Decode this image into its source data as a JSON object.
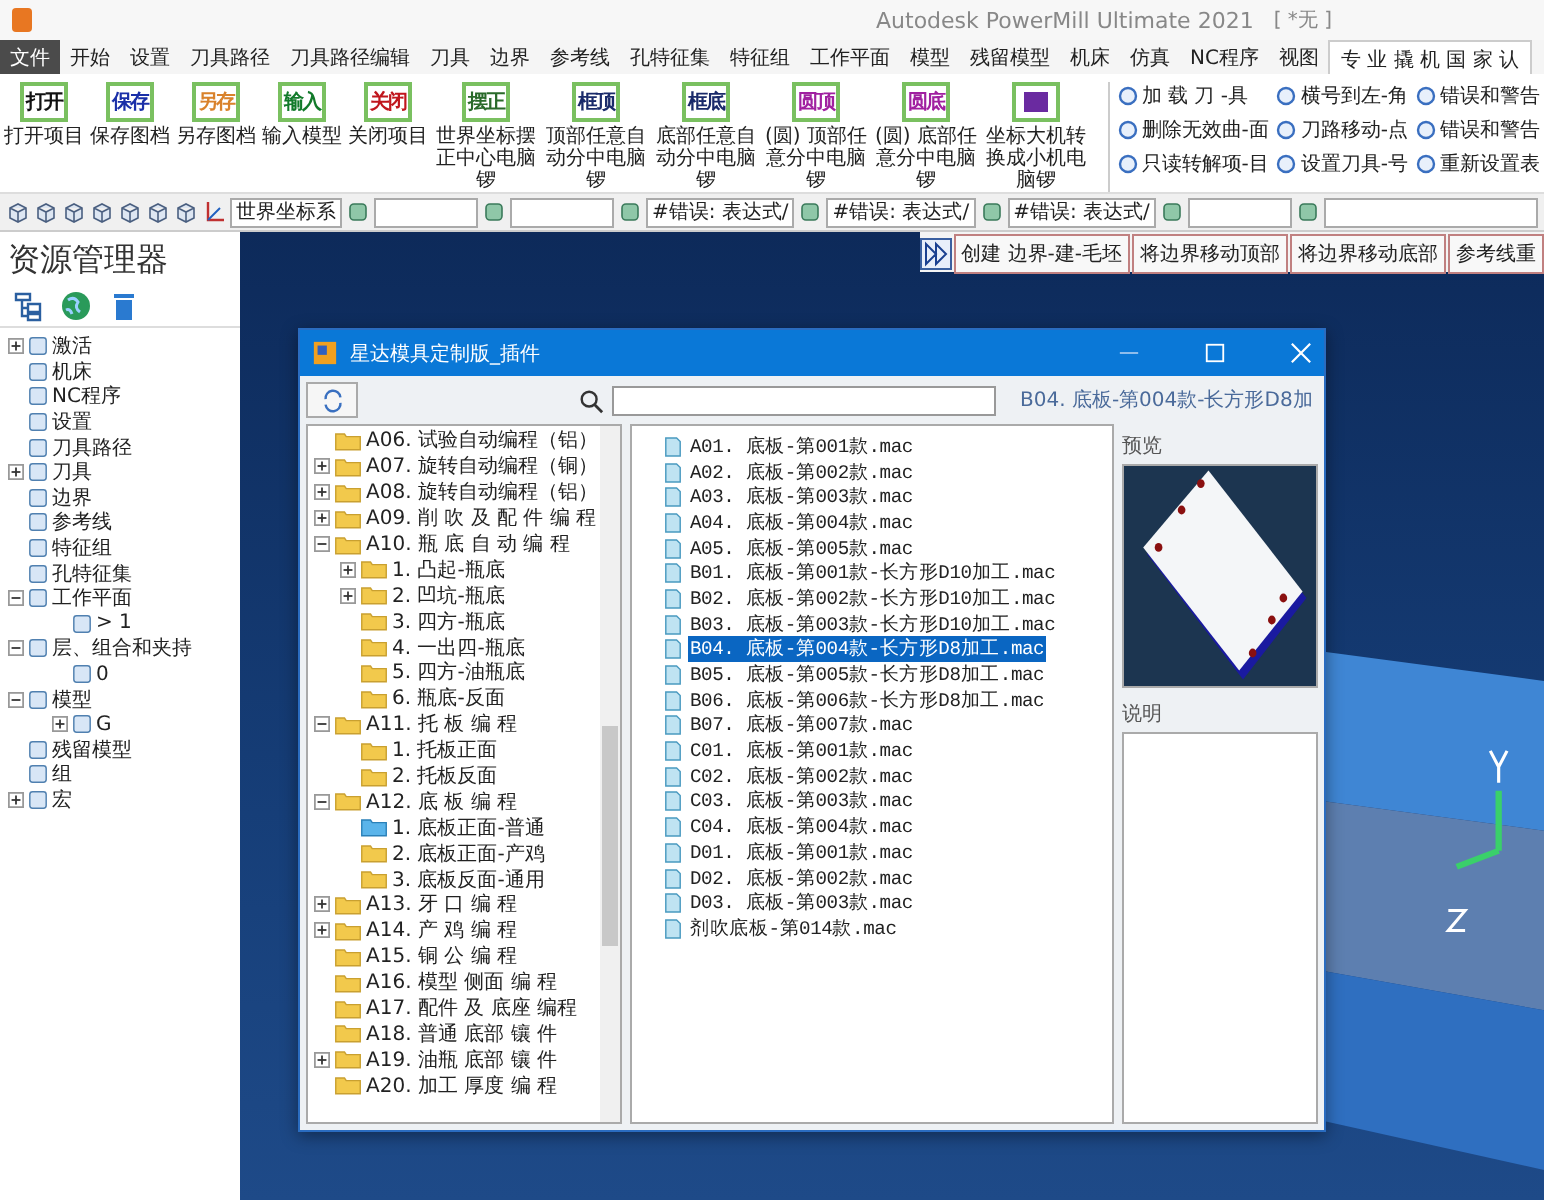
{
  "app": {
    "title": "Autodesk PowerMill Ultimate 2021",
    "document": "[ *无 ]"
  },
  "tabs": [
    {
      "label": "文件",
      "kind": "file",
      "selected": false
    },
    {
      "label": "开始",
      "kind": "tab",
      "selected": false
    },
    {
      "label": "设置",
      "kind": "tab",
      "selected": false
    },
    {
      "label": "刀具路径",
      "kind": "tab",
      "selected": false
    },
    {
      "label": "刀具路径编辑",
      "kind": "tab",
      "selected": false
    },
    {
      "label": "刀具",
      "kind": "tab",
      "selected": false
    },
    {
      "label": "边界",
      "kind": "tab",
      "selected": false
    },
    {
      "label": "参考线",
      "kind": "tab",
      "selected": false
    },
    {
      "label": "孔特征集",
      "kind": "tab",
      "selected": false
    },
    {
      "label": "特征组",
      "kind": "tab",
      "selected": false
    },
    {
      "label": "工作平面",
      "kind": "tab",
      "selected": false
    },
    {
      "label": "模型",
      "kind": "tab",
      "selected": false
    },
    {
      "label": "残留模型",
      "kind": "tab",
      "selected": false
    },
    {
      "label": "机床",
      "kind": "tab",
      "selected": false
    },
    {
      "label": "仿真",
      "kind": "tab",
      "selected": false
    },
    {
      "label": "NC程序",
      "kind": "tab",
      "selected": false
    },
    {
      "label": "视图",
      "kind": "tab",
      "selected": false
    },
    {
      "label": "专 业 撬 机 国 家 认",
      "kind": "tab",
      "selected": true
    }
  ],
  "ribbon": {
    "buttons": [
      {
        "label": "打开项目",
        "icon_text": "打开",
        "color": "#111111"
      },
      {
        "label": "保存图档",
        "icon_text": "保存",
        "color": "#1a2fa8"
      },
      {
        "label": "另存图档",
        "icon_text": "另存",
        "color": "#d9822b"
      },
      {
        "label": "输入模型",
        "icon_text": "输入",
        "color": "#127a2a"
      },
      {
        "label": "关闭项目",
        "icon_text": "关闭",
        "color": "#c0161d"
      },
      {
        "label": "世界坐标摆正中心电脑锣",
        "icon_text": "摆正",
        "color": "#2a6a2a"
      },
      {
        "label": "顶部任意自动分中电脑锣",
        "icon_text": "框顶",
        "color": "#1a2a6a"
      },
      {
        "label": "底部任意自动分中电脑锣",
        "icon_text": "框底",
        "color": "#1a2a6a"
      },
      {
        "label": "(圆) 顶部任意分中电脑锣",
        "icon_text": "圆顶",
        "color": "#a020a0"
      },
      {
        "label": "(圆) 底部任意分中电脑锣",
        "icon_text": "圆底",
        "color": "#a020a0"
      },
      {
        "label": "坐标大机转换成小机电脑锣",
        "color": "#6a2aa0"
      }
    ],
    "quick_buttons": [
      "加 载 刀 -具",
      "横号到左-角",
      "错误和警告",
      "删除无效曲-面",
      "刀路移动-点",
      "错误和警告",
      "只读转解项-目",
      "设置刀具-号",
      "重新设置表"
    ]
  },
  "toolbar": {
    "fields": [
      "世界坐标系",
      "#错误: 表达式/",
      "#错误: 表达式/",
      "#错误: 表达式/"
    ]
  },
  "explorer": {
    "title": "资源管理器",
    "tree": [
      {
        "label": "激活",
        "expanded": false
      },
      {
        "label": "机床"
      },
      {
        "label": "NC程序"
      },
      {
        "label": "设置"
      },
      {
        "label": "刀具路径"
      },
      {
        "label": "刀具",
        "expanded": false
      },
      {
        "label": "边界"
      },
      {
        "label": "参考线"
      },
      {
        "label": "特征组"
      },
      {
        "label": "孔特征集"
      },
      {
        "label": "工作平面",
        "expanded": true,
        "children": [
          {
            "label": "> 1"
          }
        ]
      },
      {
        "label": "层、组合和夹持",
        "expanded": true,
        "children": [
          {
            "label": "0"
          }
        ]
      },
      {
        "label": "模型",
        "expanded": true,
        "children": [
          {
            "label": "G",
            "expanded": false
          }
        ]
      },
      {
        "label": "残留模型"
      },
      {
        "label": "组"
      },
      {
        "label": "宏",
        "expanded": false
      }
    ]
  },
  "viewport": {
    "buttons": [
      "创建 边界-建-毛坯",
      "将边界移动顶部",
      "将边界移动底部",
      "参考线重"
    ]
  },
  "dialog": {
    "title": "星达模具定制版_插件",
    "tree": [
      {
        "label": "A06. 试验自动编程（铝）",
        "selected": false
      },
      {
        "label": "A07. 旋转自动编程（铜）",
        "expanded": false,
        "selected": false
      },
      {
        "label": "A08. 旋转自动编程（铝）",
        "expanded": false,
        "selected": false
      },
      {
        "label": "A09. 削 吹 及 配 件 编 程",
        "expanded": false,
        "selected": false
      },
      {
        "label": "A10. 瓶 底 自 动 编 程",
        "expanded": true,
        "selected": false,
        "children": [
          {
            "label": "1. 凸起-瓶底",
            "expanded": false,
            "selected": false
          },
          {
            "label": "2. 凹坑-瓶底",
            "expanded": false,
            "selected": false
          },
          {
            "label": "3. 四方-瓶底",
            "selected": false
          },
          {
            "label": "4. 一出四-瓶底",
            "selected": false
          },
          {
            "label": "5. 四方-油瓶底",
            "selected": false
          },
          {
            "label": "6. 瓶底-反面",
            "selected": false
          }
        ]
      },
      {
        "label": "A11. 托 板 编 程",
        "expanded": true,
        "selected": false,
        "children": [
          {
            "label": "1. 托板正面",
            "selected": false
          },
          {
            "label": "2. 托板反面",
            "selected": false
          }
        ]
      },
      {
        "label": "A12. 底 板 编 程",
        "expanded": true,
        "selected": false,
        "children": [
          {
            "label": "1. 底板正面-普通",
            "selected": true
          },
          {
            "label": "2. 底板正面-产鸡",
            "selected": false
          },
          {
            "label": "3. 底板反面-通用",
            "selected": false
          }
        ]
      },
      {
        "label": "A13. 牙 口 编 程",
        "expanded": false,
        "selected": false
      },
      {
        "label": "A14. 产 鸡 编 程",
        "expanded": false,
        "selected": false
      },
      {
        "label": "A15. 铜 公 编 程",
        "selected": false
      },
      {
        "label": "A16. 模型 侧面 编 程",
        "selected": false
      },
      {
        "label": "A17. 配件 及 底座 编程",
        "selected": false
      },
      {
        "label": "A18. 普通 底部 镶 件",
        "selected": false
      },
      {
        "label": "A19. 油瓶 底部 镶 件",
        "expanded": false,
        "selected": false
      },
      {
        "label": "A20. 加工 厚度 编 程",
        "selected": false
      }
    ],
    "files": [
      {
        "label": "A01. 底板-第001款.mac",
        "selected": false
      },
      {
        "label": "A02. 底板-第002款.mac",
        "selected": false
      },
      {
        "label": "A03. 底板-第003款.mac",
        "selected": false
      },
      {
        "label": "A04. 底板-第004款.mac",
        "selected": false
      },
      {
        "label": "A05. 底板-第005款.mac",
        "selected": false
      },
      {
        "label": "B01. 底板-第001款-长方形D10加工.mac",
        "selected": false
      },
      {
        "label": "B02. 底板-第002款-长方形D10加工.mac",
        "selected": false
      },
      {
        "label": "B03. 底板-第003款-长方形D10加工.mac",
        "selected": false
      },
      {
        "label": "B04. 底板-第004款-长方形D8加工.mac",
        "selected": true
      },
      {
        "label": "B05. 底板-第005款-长方形D8加工.mac",
        "selected": false
      },
      {
        "label": "B06. 底板-第006款-长方形D8加工.mac",
        "selected": false
      },
      {
        "label": "B07. 底板-第007款.mac",
        "selected": false
      },
      {
        "label": "C01. 底板-第001款.mac",
        "selected": false
      },
      {
        "label": "C02. 底板-第002款.mac",
        "selected": false
      },
      {
        "label": "C03. 底板-第003款.mac",
        "selected": false
      },
      {
        "label": "C04. 底板-第004款.mac",
        "selected": false
      },
      {
        "label": "D01. 底板-第001款.mac",
        "selected": false
      },
      {
        "label": "D02. 底板-第002款.mac",
        "selected": false
      },
      {
        "label": "D03. 底板-第003款.mac",
        "selected": false
      },
      {
        "label": "剂吹底板-第014款.mac",
        "selected": false
      }
    ],
    "selected_name": "B04. 底板-第004款-长方形D8加",
    "preview_label": "预览",
    "description_label": "说明"
  }
}
